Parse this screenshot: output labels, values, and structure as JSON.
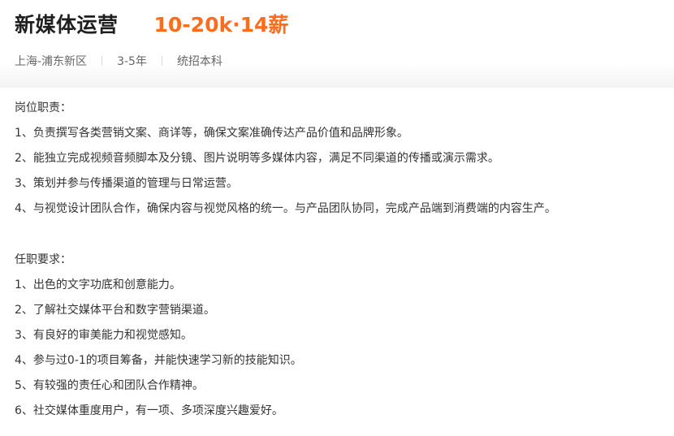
{
  "job": {
    "title": "新媒体运营",
    "salary": "10-20k·14薪",
    "location": "上海-浦东新区",
    "experience": "3-5年",
    "education": "统招本科"
  },
  "duties": {
    "heading": "岗位职责：",
    "items": [
      "1、负责撰写各类营销文案、商详等，确保文案准确传达产品价值和品牌形象。",
      "2、能独立完成视频音频脚本及分镜、图片说明等多媒体内容，满足不同渠道的传播或演示需求。",
      "3、策划并参与传播渠道的管理与日常运营。",
      "4、与视觉设计团队合作，确保内容与视觉风格的统一。与产品团队协同，完成产品端到消费端的内容生产。"
    ]
  },
  "requirements": {
    "heading": "任职要求：",
    "items": [
      "1、出色的文字功底和创意能力。",
      "2、了解社交媒体平台和数字营销渠道。",
      "3、有良好的审美能力和视觉感知。",
      "4、参与过0-1的项目筹备，并能快速学习新的技能知识。",
      "5、有较强的责任心和团队合作精神。",
      "6、社交媒体重度用户，有一项、多项深度兴趣爱好。"
    ]
  },
  "colors": {
    "salary": "#fe6d1e",
    "title": "#1f1f1f",
    "meta": "#666666",
    "body": "#333333"
  }
}
